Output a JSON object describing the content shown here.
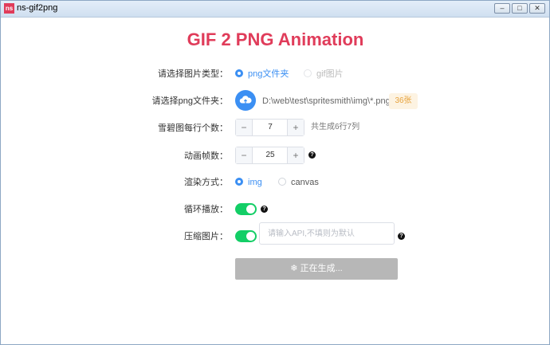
{
  "window": {
    "title": "ns-gif2png",
    "icon_text": "ns"
  },
  "page": {
    "title": "GIF 2 PNG Animation"
  },
  "form": {
    "image_type": {
      "label": "请选择图片类型：",
      "options": [
        "png文件夹",
        "gif图片"
      ]
    },
    "folder": {
      "label": "请选择png文件夹：",
      "path": "D:\\web\\test\\spritesmith\\img\\*.png",
      "count": "36张"
    },
    "per_row": {
      "label": "雪碧图每行个数：",
      "value": "7",
      "hint": "共生成6行7列"
    },
    "frames": {
      "label": "动画帧数：",
      "value": "25"
    },
    "render": {
      "label": "渲染方式：",
      "options": [
        "img",
        "canvas"
      ]
    },
    "loop": {
      "label": "循环播放："
    },
    "compress": {
      "label": "压缩图片：",
      "placeholder": "请输入API,不填则为默认"
    },
    "submit": {
      "label": "正在生成..."
    }
  },
  "icons": {
    "help": "?",
    "minus": "−",
    "plus": "+",
    "loading": "❄",
    "min": "–",
    "max": "□",
    "close": "✕"
  }
}
